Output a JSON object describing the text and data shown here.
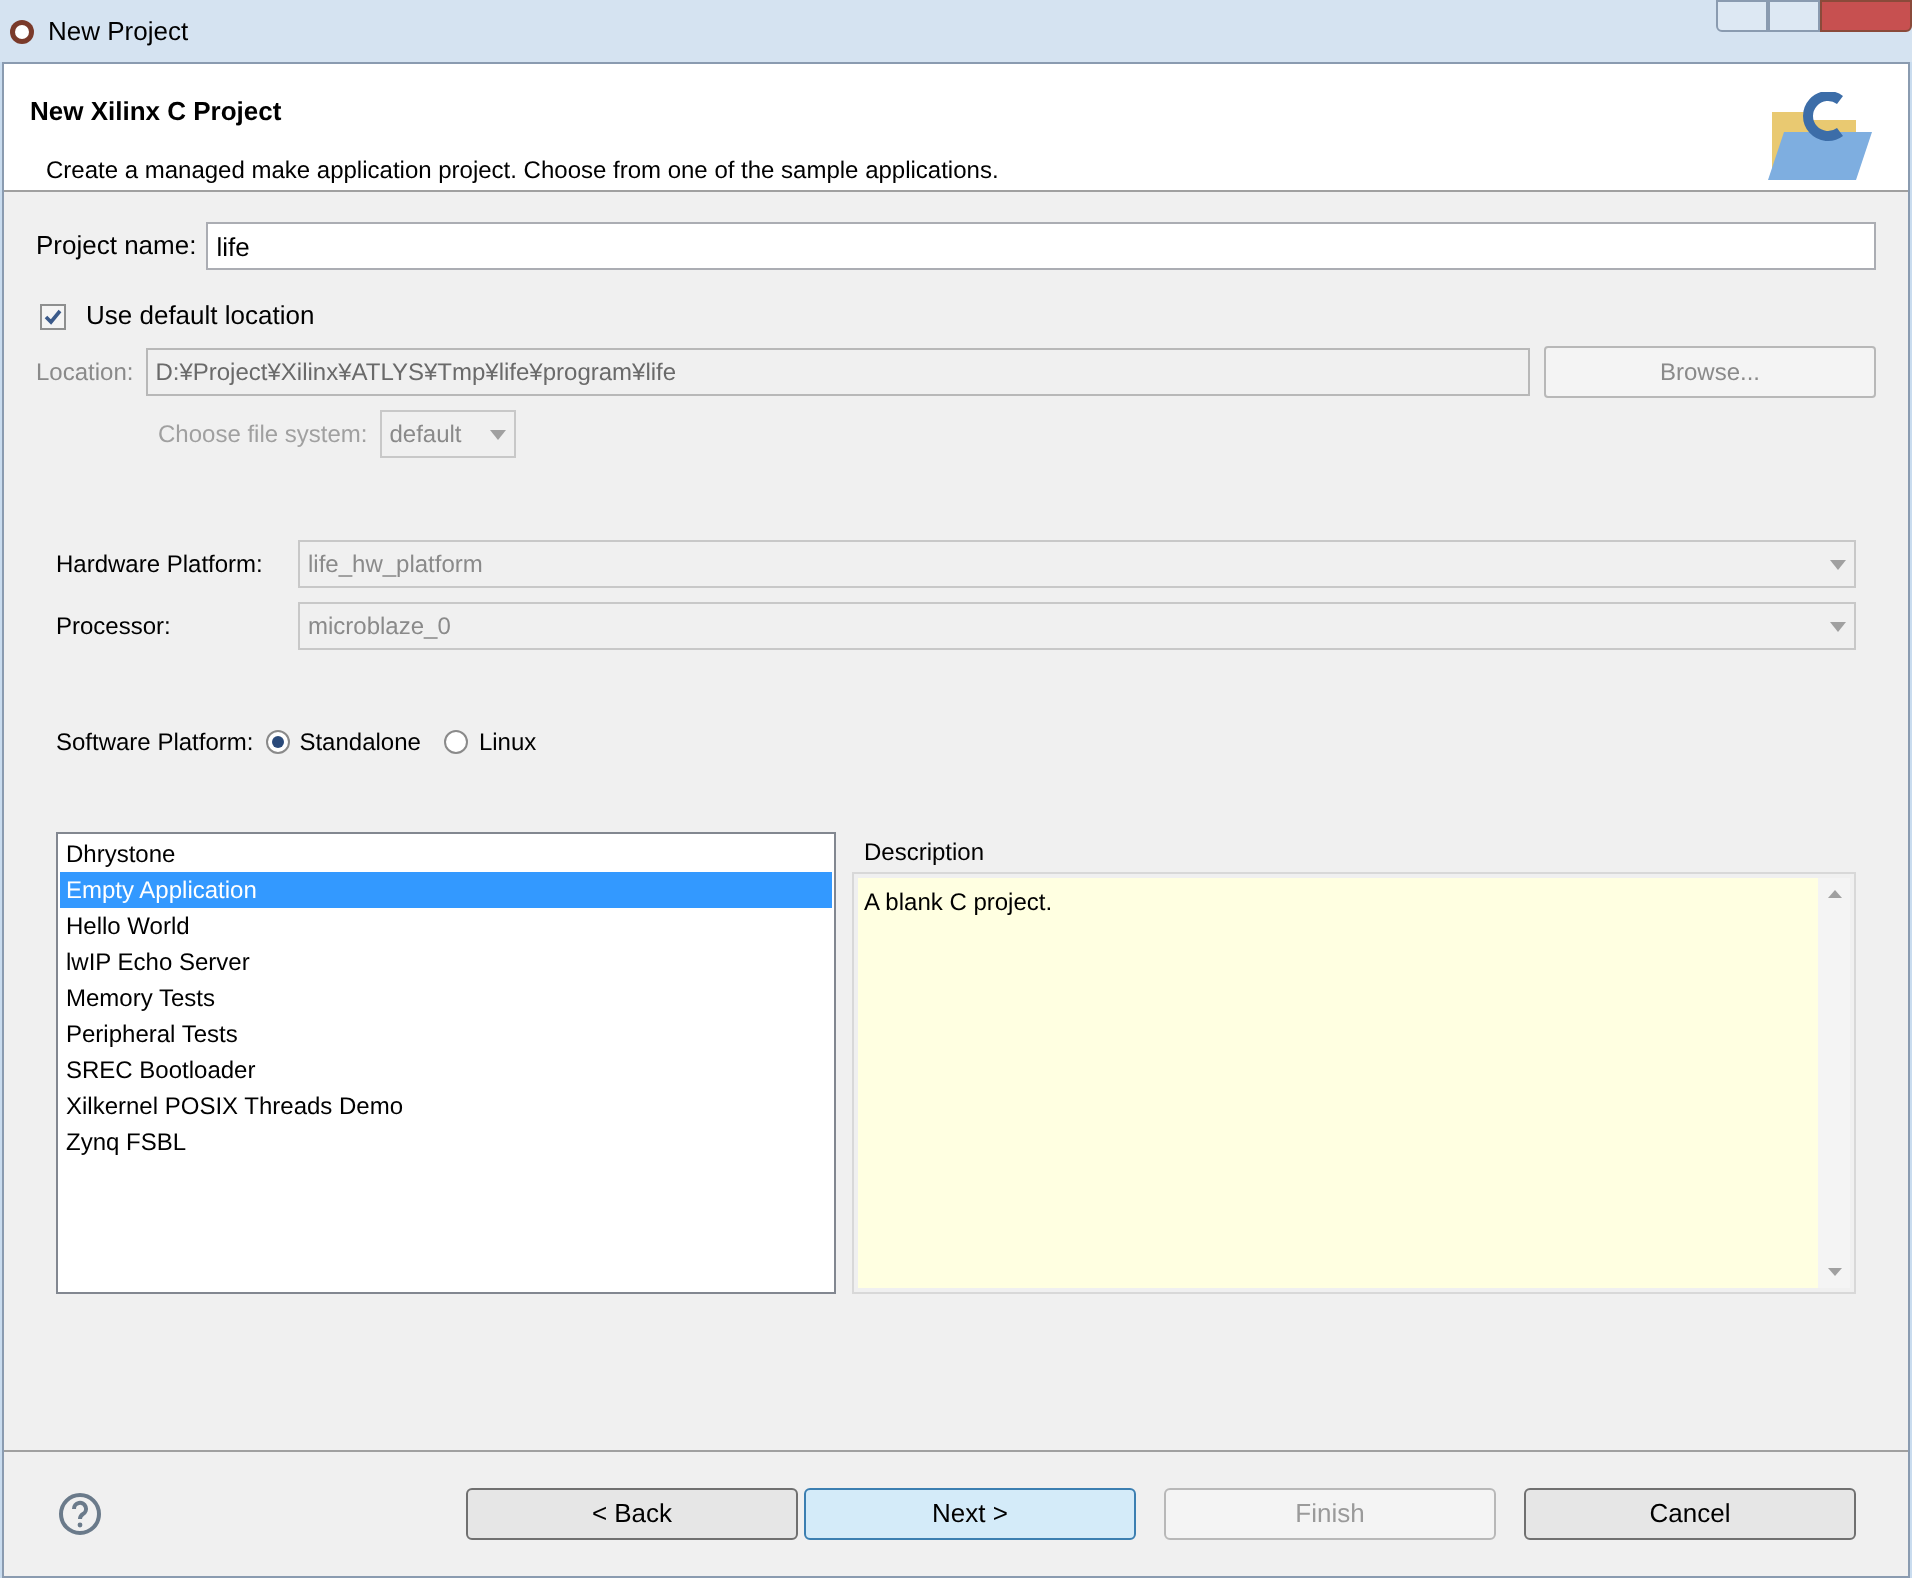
{
  "window": {
    "title": "New Project"
  },
  "header": {
    "title": "New Xilinx C Project",
    "description": "Create a managed make application project. Choose from one of the sample applications."
  },
  "project_name": {
    "label": "Project name:",
    "value": "life"
  },
  "default_location": {
    "label": "Use default location",
    "checked": true
  },
  "location": {
    "label": "Location:",
    "value": "D:¥Project¥Xilinx¥ATLYS¥Tmp¥life¥program¥life",
    "disabled": true
  },
  "browse": {
    "label": "Browse...",
    "disabled": true
  },
  "file_system": {
    "label": "Choose file system:",
    "value": "default",
    "disabled": true
  },
  "hardware_platform": {
    "label": "Hardware Platform:",
    "value": "life_hw_platform",
    "disabled": true
  },
  "processor": {
    "label": "Processor:",
    "value": "microblaze_0",
    "disabled": true
  },
  "software_platform": {
    "label": "Software Platform:",
    "options": [
      {
        "label": "Standalone",
        "selected": true
      },
      {
        "label": "Linux",
        "selected": false
      }
    ]
  },
  "templates": [
    {
      "label": "Dhrystone",
      "selected": false
    },
    {
      "label": "Empty Application",
      "selected": true
    },
    {
      "label": "Hello World",
      "selected": false
    },
    {
      "label": "lwIP Echo Server",
      "selected": false
    },
    {
      "label": "Memory Tests",
      "selected": false
    },
    {
      "label": "Peripheral Tests",
      "selected": false
    },
    {
      "label": "SREC Bootloader",
      "selected": false
    },
    {
      "label": "Xilkernel POSIX Threads Demo",
      "selected": false
    },
    {
      "label": "Zynq FSBL",
      "selected": false
    }
  ],
  "description": {
    "title": "Description",
    "text": "A blank C project."
  },
  "buttons": [
    {
      "label": "< Back",
      "disabled": false,
      "default": false
    },
    {
      "label": "Next >",
      "disabled": false,
      "default": true
    },
    {
      "label": "Finish",
      "disabled": true,
      "default": false
    },
    {
      "label": "Cancel",
      "disabled": false,
      "default": false
    }
  ]
}
